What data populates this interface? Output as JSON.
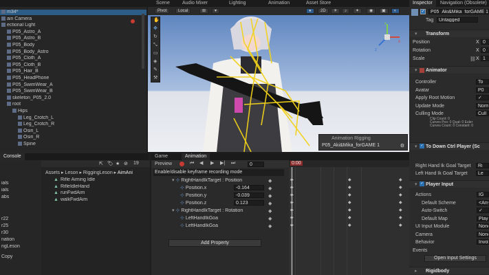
{
  "top_toolbar": {
    "tabs": [
      "Scene",
      "Audio Mixer",
      "Lighting",
      "Animation",
      "Asset Store"
    ],
    "right_tabs": [
      "Inspector",
      "Navigation (Obsolete)"
    ],
    "pivot": "Pivot",
    "local": "Local"
  },
  "hierarchy": {
    "items": [
      "m34*",
      "ain Camera",
      "ectional Light",
      "P05_Astro_A",
      "P05_Astro_B",
      "P05_Body",
      "P05_Body_Astro",
      "P05_Cloth_A",
      "P05_Cloth_B",
      "P05_Hair_B",
      "P05_HeadPhone",
      "P05_SwimWear_A",
      "P05_SwimWear_B",
      "skeleton_P05_2.0",
      "root",
      "Hips",
      "Leg_Crotch_L",
      "Leg_Crotch_R",
      "Osiri_L",
      "Osiri_R",
      "Spine"
    ]
  },
  "scene_view": {
    "overlay_title": "Animation Rigging",
    "overlay_value": "P05_Aki&Mika_forGAME 1",
    "axis_labels": [
      "y",
      "x",
      "z"
    ],
    "persp_label": ""
  },
  "console": {
    "tab": "Console",
    "items": [
      "ials",
      "ials",
      "abs",
      "r22",
      "r25",
      "r30",
      "nation",
      "ngLeson",
      "Copy"
    ]
  },
  "project": {
    "breadcrumb": [
      "Assets",
      "Leson",
      "RiggingLeson",
      "AimAni"
    ],
    "count": "19",
    "files": [
      "Rifle Aiming Idle",
      "RifleIdleHand",
      "runFwdAim",
      "walkFwdAim"
    ]
  },
  "animation": {
    "tabs": [
      "Game",
      "Animation"
    ],
    "preview": "Preview",
    "frame": "0",
    "tooltip": "Enable/disable keyframe recording mode",
    "timeline_marker": "0:00",
    "props": [
      {
        "name": "RightHandIkTarget : Position",
        "value": "",
        "indent": 0
      },
      {
        "name": "Position.x",
        "value": "-0.164",
        "indent": 1
      },
      {
        "name": "Position.y",
        "value": "-0.039",
        "indent": 1
      },
      {
        "name": "Position.z",
        "value": "0.123",
        "indent": 1
      },
      {
        "name": "RightHandIkTarget : Rotation",
        "value": "",
        "indent": 0
      },
      {
        "name": "LeftHandIkGoa",
        "value": "",
        "indent": 1
      },
      {
        "name": "LeftHandIkGoa",
        "value": "",
        "indent": 1
      }
    ],
    "add_property": "Add Property"
  },
  "inspector": {
    "object_name": "P05_Aki&Mika_forGAME 1",
    "tag_label": "Tag",
    "tag_value": "Untagged",
    "transform": {
      "title": "Transform",
      "position": "Position",
      "rotation": "Rotation",
      "scale": "Scale",
      "axis": [
        "X",
        "X",
        "X"
      ],
      "values": [
        "0",
        "0",
        "1"
      ]
    },
    "animator": {
      "title": "Animator",
      "rows": [
        {
          "label": "Controller",
          "value": "To"
        },
        {
          "label": "Avatar",
          "value": "P0"
        },
        {
          "label": "Apply Root Motion",
          "value": "✓"
        },
        {
          "label": "Update Mode",
          "value": "Norm"
        },
        {
          "label": "Culling Mode",
          "value": "Cull"
        }
      ],
      "info": [
        "Clip Count: 0",
        "Curves Pos: 0 Quat: 0 Euler",
        "Curves Count: 0 Constant: 0"
      ]
    },
    "to_down": {
      "title": "To Down Ctrl Player (Sc",
      "rows": [
        {
          "label": "Right Hand Ik Goal Target",
          "value": "Ri"
        },
        {
          "label": "Left Hand Ik Goal Target",
          "value": "Le"
        }
      ]
    },
    "player_input": {
      "title": "Player Input",
      "rows": [
        {
          "label": "Actions",
          "value": "IG"
        },
        {
          "label": "Default Scheme",
          "value": "<Any"
        },
        {
          "label": "Auto-Switch",
          "value": "✓"
        },
        {
          "label": "Default Map",
          "value": "Playe"
        },
        {
          "label": "UI Input Module",
          "value": "None"
        },
        {
          "label": "Camera",
          "value": "None"
        },
        {
          "label": "Behavior",
          "value": "Invok"
        }
      ],
      "events": "Events",
      "open_settings": "Open Input Settings"
    },
    "rigidbody": {
      "title": "Rigidbody"
    }
  },
  "colors": {
    "accent": "#2c5d87",
    "scene_sky": "#6a8fc4",
    "scene_ground": "#e8e9ee",
    "rig_yellow": "#f2d21a",
    "play_red": "#c83a32"
  }
}
